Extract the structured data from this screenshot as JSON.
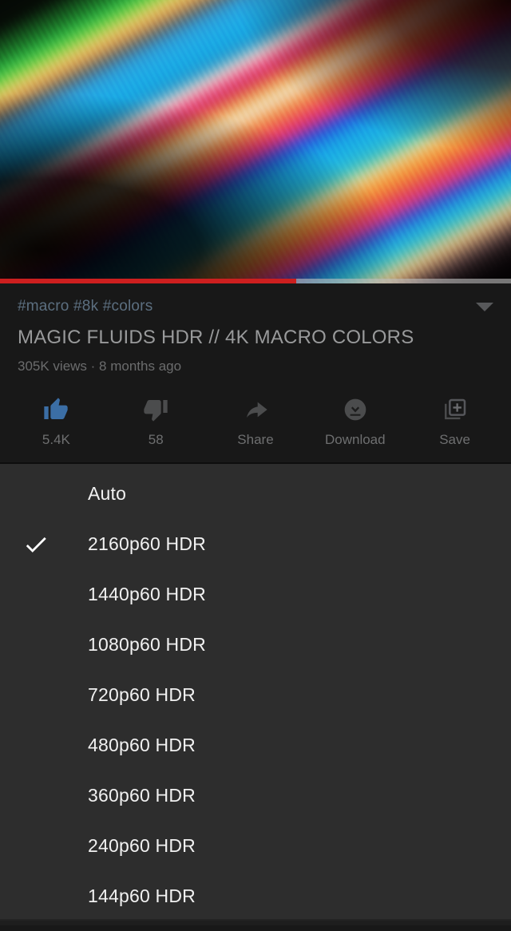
{
  "player": {
    "progress_percent": 58,
    "progress_played_color": "#cc1f1f",
    "progress_track_color": "#bebebe"
  },
  "video": {
    "hashtags": "#macro #8k #colors",
    "title": "MAGIC FLUIDS HDR // 4K MACRO COLORS",
    "subinfo": "305K views · 8 months ago",
    "expand_icon": "chevron-down-icon"
  },
  "actions": [
    {
      "icon": "thumbs-up-icon",
      "label": "5.4K",
      "active": true,
      "color": "#3b6ea5"
    },
    {
      "icon": "thumbs-down-icon",
      "label": "58",
      "active": false,
      "color": "#4b4c4d"
    },
    {
      "icon": "share-icon",
      "label": "Share",
      "active": false,
      "color": "#4b4c4d"
    },
    {
      "icon": "download-icon",
      "label": "Download",
      "active": false,
      "color": "#4b4c4d"
    },
    {
      "icon": "save-icon",
      "label": "Save",
      "active": false,
      "color": "#4b4c4d"
    }
  ],
  "quality_menu": {
    "selected_index": 1,
    "check_icon": "check-icon",
    "items": [
      {
        "label": "Auto"
      },
      {
        "label": "2160p60 HDR"
      },
      {
        "label": "1440p60 HDR"
      },
      {
        "label": "1080p60 HDR"
      },
      {
        "label": "720p60 HDR"
      },
      {
        "label": "480p60 HDR"
      },
      {
        "label": "360p60 HDR"
      },
      {
        "label": "240p60 HDR"
      },
      {
        "label": "144p60 HDR"
      }
    ]
  },
  "theme": {
    "page_bg": "#0f0f0f",
    "meta_bg": "#181818",
    "menu_bg": "#2d2d2d",
    "accent_blue": "#3b6ea5",
    "text_primary": "#f1f1f1",
    "text_dim": "#6e6f70"
  }
}
